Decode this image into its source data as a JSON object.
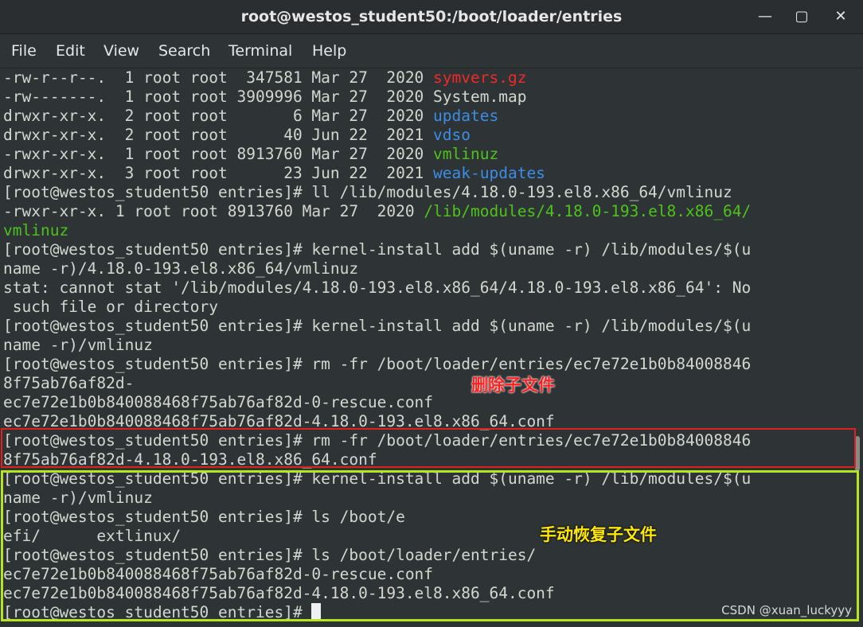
{
  "window": {
    "title": "root@westos_student50:/boot/loader/entries",
    "minimize": "—",
    "maximize": "▢",
    "close": "✕"
  },
  "menu": [
    "File",
    "Edit",
    "View",
    "Search",
    "Terminal",
    "Help"
  ],
  "lines": [
    {
      "a": "-rw-r--r--.  1 root root  347581 Mar 27  2020 ",
      "b": "symvers.gz"
    },
    {
      "a": "-rw-------.  1 root root 3909996 Mar 27  2020 System.map",
      "b": ""
    },
    {
      "a": "drwxr-xr-x.  2 root root       6 Mar 27  2020 ",
      "b": "updates"
    },
    {
      "a": "drwxr-xr-x.  2 root root      40 Jun 22  2021 ",
      "b": "vdso"
    },
    {
      "a": "-rwxr-xr-x.  1 root root 8913760 Mar 27  2020 ",
      "b": "vmlinuz"
    },
    {
      "a": "drwxr-xr-x.  3 root root      23 Jun 22  2021 ",
      "b": "weak-updates"
    },
    {
      "a": "[root@westos_student50 entries]# ll /lib/modules/4.18.0-193.el8.x86_64/vmlinuz",
      "b": ""
    },
    {
      "a": "-rwxr-xr-x. 1 root root 8913760 Mar 27  2020 ",
      "b": "/lib/modules/4.18.0-193.el8.x86_64/"
    },
    {
      "a": "",
      "b": "vmlinuz"
    },
    {
      "a": "[root@westos_student50 entries]# kernel-install add $(uname -r) /lib/modules/$(u",
      "b": ""
    },
    {
      "a": "name -r)/4.18.0-193.el8.x86_64/vmlinuz",
      "b": ""
    },
    {
      "a": "stat: cannot stat '/lib/modules/4.18.0-193.el8.x86_64/4.18.0-193.el8.x86_64': No",
      "b": ""
    },
    {
      "a": " such file or directory",
      "b": ""
    },
    {
      "a": "[root@westos_student50 entries]# kernel-install add $(uname -r) /lib/modules/$(u",
      "b": ""
    },
    {
      "a": "name -r)/vmlinuz",
      "b": ""
    },
    {
      "a": "[root@westos_student50 entries]# rm -fr /boot/loader/entries/ec7e72e1b0b84008846",
      "b": ""
    },
    {
      "a": "8f75ab76af82d-",
      "b": ""
    },
    {
      "a": "ec7e72e1b0b840088468f75ab76af82d-0-rescue.conf",
      "b": ""
    },
    {
      "a": "ec7e72e1b0b840088468f75ab76af82d-4.18.0-193.el8.x86_64.conf",
      "b": ""
    },
    {
      "a": "[root@westos_student50 entries]# rm -fr /boot/loader/entries/ec7e72e1b0b84008846",
      "b": ""
    },
    {
      "a": "8f75ab76af82d-4.18.0-193.el8.x86_64.conf",
      "b": ""
    },
    {
      "a": "[root@westos_student50 entries]# kernel-install add $(uname -r) /lib/modules/$(u",
      "b": ""
    },
    {
      "a": "name -r)/vmlinuz",
      "b": ""
    },
    {
      "a": "[root@westos_student50 entries]# ls /boot/e",
      "b": ""
    },
    {
      "a": "efi/      extlinux/",
      "b": ""
    },
    {
      "a": "[root@westos_student50 entries]# ls /boot/loader/entries/",
      "b": ""
    },
    {
      "a": "ec7e72e1b0b840088468f75ab76af82d-0-rescue.conf",
      "b": ""
    },
    {
      "a": "ec7e72e1b0b840088468f75ab76af82d-4.18.0-193.el8.x86_64.conf",
      "b": ""
    },
    {
      "a": "[root@westos_student50 entries]# ",
      "b": ""
    }
  ],
  "annotations": {
    "delete": "删除子文件",
    "restore": "手动恢复子文件"
  },
  "watermark": "CSDN @xuan_luckyyy",
  "colors": {
    "background": "#2e3436",
    "text": "#d3d7cf",
    "archive": "#ef2929",
    "directory": "#3c8de6",
    "executable": "#4ec21a"
  }
}
